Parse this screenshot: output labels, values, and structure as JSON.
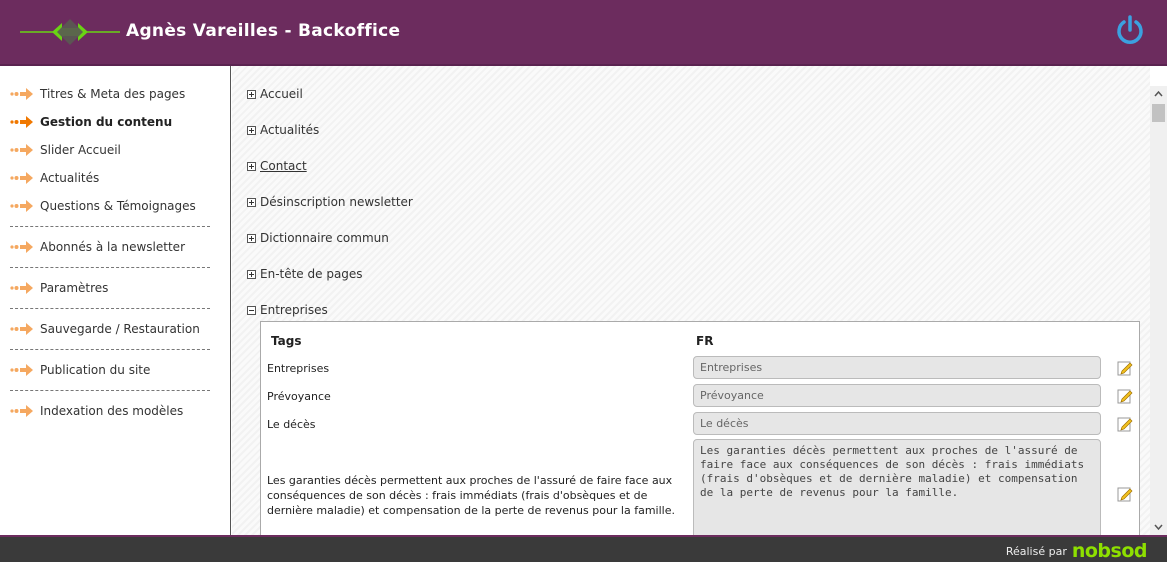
{
  "header": {
    "title": "Agnès Vareilles - Backoffice",
    "logo_icon": "diamond-arrows-logo-icon",
    "power_icon": "power-icon",
    "colors": {
      "bar": "#6c2c5e",
      "power": "#3ba1e0",
      "logo_green": "#6ad314"
    }
  },
  "sidebar": {
    "items": [
      {
        "label": "Titres & Meta des pages",
        "active": false
      },
      {
        "label": "Gestion du contenu",
        "active": true
      },
      {
        "label": "Slider Accueil",
        "active": false
      },
      {
        "label": "Actualités",
        "active": false
      },
      {
        "label": "Questions & Témoignages",
        "active": false
      },
      {
        "label": "Abonnés à la newsletter",
        "active": false
      },
      {
        "label": "Paramètres",
        "active": false
      },
      {
        "label": "Sauvegarde / Restauration",
        "active": false
      },
      {
        "label": "Publication du site",
        "active": false
      },
      {
        "label": "Indexation des modèles",
        "active": false
      }
    ],
    "arrow_icon": "arrow-right-icon",
    "colors": {
      "arrow": "#f5a860",
      "arrow_active": "#f07800"
    }
  },
  "sections": [
    {
      "label": "Accueil",
      "expanded": false
    },
    {
      "label": "Actualités",
      "expanded": false
    },
    {
      "label": "Contact",
      "expanded": false
    },
    {
      "label": "Désinscription newsletter",
      "expanded": false
    },
    {
      "label": "Dictionnaire commun",
      "expanded": false
    },
    {
      "label": "En-tête de pages",
      "expanded": false
    },
    {
      "label": "Entreprises",
      "expanded": true
    }
  ],
  "table": {
    "col_tags": "Tags",
    "col_lang": "FR",
    "rows": [
      {
        "tag": "Entreprises",
        "value": "Entreprises"
      },
      {
        "tag": "Prévoyance",
        "value": "Prévoyance"
      },
      {
        "tag": "Le décès",
        "value": "Le décès"
      },
      {
        "tag": "Les garanties décès permettent aux proches de l'assuré de faire face aux conséquences de son décès : frais immédiats (frais d'obsèques et de dernière maladie) et compensation de la perte de revenus pour la famille.",
        "value": "Les garanties décès permettent aux proches de l'assuré de faire face aux conséquences de son décès : frais immédiats (frais d'obsèques et de dernière maladie) et compensation de la perte de revenus pour la famille."
      }
    ],
    "edit_icon": "pencil-edit-icon"
  },
  "footer": {
    "credit_label": "Réalisé par",
    "brand": "nobsod"
  }
}
